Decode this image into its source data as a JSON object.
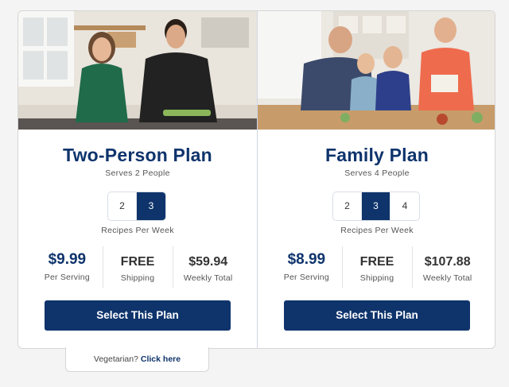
{
  "plans": [
    {
      "title": "Two-Person Plan",
      "serves": "Serves 2 People",
      "recipe_options": [
        "2",
        "3"
      ],
      "selected_recipes": "3",
      "recipes_label": "Recipes Per Week",
      "price_per_serving": "$9.99",
      "per_serving_label": "Per Serving",
      "shipping": "FREE",
      "shipping_label": "Shipping",
      "weekly_total": "$59.94",
      "weekly_total_label": "Weekly Total",
      "button_label": "Select This Plan"
    },
    {
      "title": "Family Plan",
      "serves": "Serves 4 People",
      "recipe_options": [
        "2",
        "3",
        "4"
      ],
      "selected_recipes": "3",
      "recipes_label": "Recipes Per Week",
      "price_per_serving": "$8.99",
      "per_serving_label": "Per Serving",
      "shipping": "FREE",
      "shipping_label": "Shipping",
      "weekly_total": "$107.88",
      "weekly_total_label": "Weekly Total",
      "button_label": "Select This Plan"
    }
  ],
  "vegetarian": {
    "prompt": "Vegetarian?",
    "link": "Click here"
  },
  "colors": {
    "brand_navy": "#0f346c",
    "card_border": "#d6d6d6"
  }
}
